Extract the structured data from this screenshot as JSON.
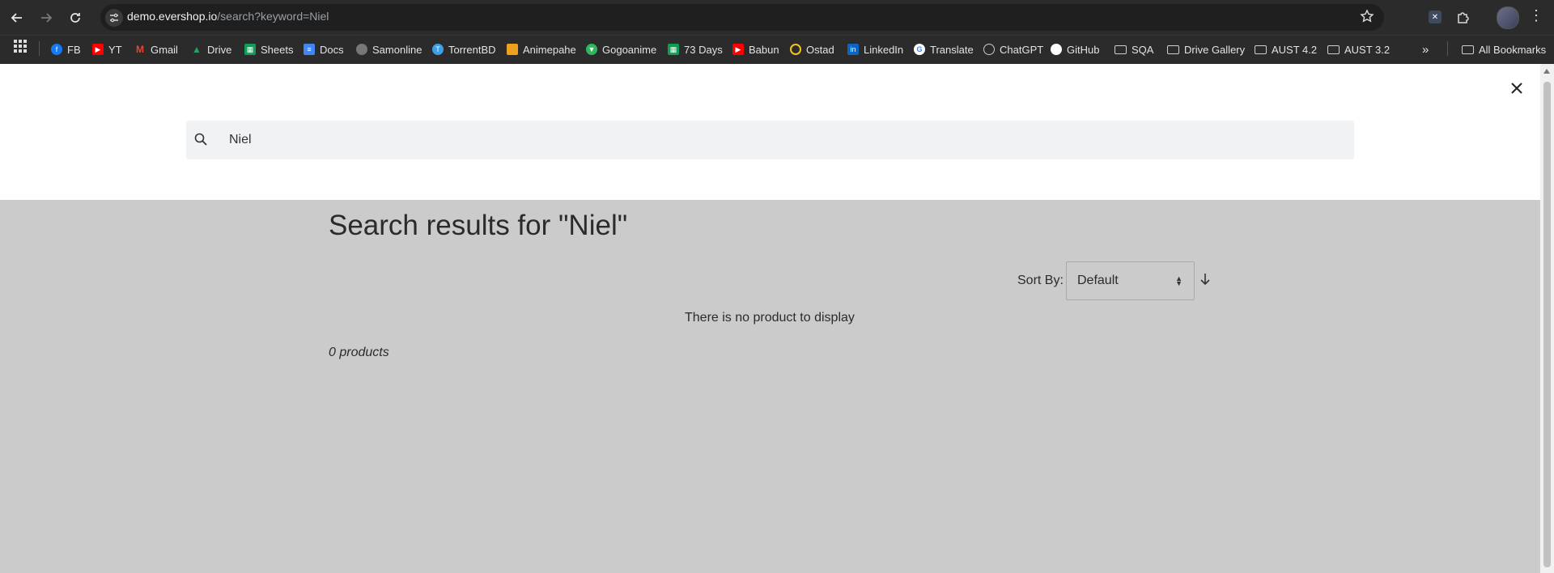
{
  "browser": {
    "url_host": "demo.evershop.io",
    "url_path": "/search?keyword=Niel",
    "bookmarks": [
      {
        "label": "FB",
        "icon": "facebook-icon",
        "color": "#1877f2"
      },
      {
        "label": "YT",
        "icon": "youtube-icon",
        "color": "#ff0000"
      },
      {
        "label": "Gmail",
        "icon": "gmail-icon",
        "color": "#ea4335"
      },
      {
        "label": "Drive",
        "icon": "drive-icon",
        "color": "#1fa463"
      },
      {
        "label": "Sheets",
        "icon": "sheets-icon",
        "color": "#0f9d58"
      },
      {
        "label": "Docs",
        "icon": "docs-icon",
        "color": "#4285f4"
      },
      {
        "label": "Samonline",
        "icon": "globe-icon",
        "color": "#888888"
      },
      {
        "label": "TorrentBD",
        "icon": "torrentbd-icon",
        "color": "#3ba0e6"
      },
      {
        "label": "Animepahe",
        "icon": "animepahe-icon",
        "color": "#f0a020"
      },
      {
        "label": "Gogoanime",
        "icon": "gogoanime-icon",
        "color": "#2fb85a"
      },
      {
        "label": "73 Days",
        "icon": "sheets-icon",
        "color": "#0f9d58"
      },
      {
        "label": "Babun",
        "icon": "youtube-icon",
        "color": "#ff0000"
      },
      {
        "label": "Ostad",
        "icon": "ostad-icon",
        "color": "#f5c518"
      },
      {
        "label": "LinkedIn",
        "icon": "linkedin-icon",
        "color": "#0a66c2"
      },
      {
        "label": "Translate",
        "icon": "google-icon",
        "color": "#ffffff"
      },
      {
        "label": "ChatGPT",
        "icon": "chatgpt-icon",
        "color": "#cccccc"
      },
      {
        "label": "GitHub",
        "icon": "github-icon",
        "color": "#ffffff"
      },
      {
        "label": "SQA",
        "icon": "folder-icon"
      },
      {
        "label": "Drive Gallery",
        "icon": "folder-icon"
      },
      {
        "label": "AUST 4.2",
        "icon": "folder-icon"
      },
      {
        "label": "AUST 3.2",
        "icon": "folder-icon"
      }
    ],
    "all_bookmarks": "All Bookmarks"
  },
  "search": {
    "value": "Niel"
  },
  "results": {
    "title": "Search results for \"Niel\"",
    "sort_label": "Sort By:",
    "sort_value": "Default",
    "empty_message": "There is no product to display",
    "count": "0 products"
  }
}
